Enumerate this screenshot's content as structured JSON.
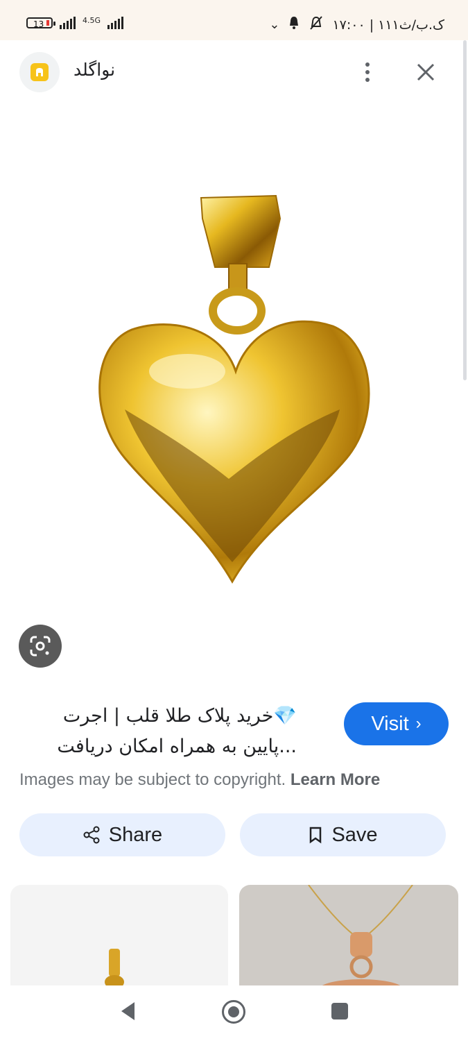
{
  "status_bar": {
    "battery": "13",
    "network": "4.5G",
    "time_text": "۱۷:۰۰ | ۱۱۱ک.ب/ث"
  },
  "header": {
    "site_name": "نواگلد",
    "app_icon": "navagold-app-icon",
    "menu_icon": "more-vert-icon",
    "close_icon": "close-icon"
  },
  "main_image": {
    "subject": "gold-heart-pendant"
  },
  "result": {
    "emoji": "💎",
    "title_line1": "💎خرید پلاک طلا قلب | اجرت",
    "title_line2": "...پایین به همراه امکان دریافت",
    "visit_label": "Visit",
    "copyright_text": "Images may be subject to copyright.",
    "learn_more": "Learn More"
  },
  "actions": {
    "share_label": "Share",
    "save_label": "Save"
  },
  "colors": {
    "accent": "#1a73e8",
    "button_bg": "#e8f0fe",
    "status_bar_bg": "#fbf5ee",
    "gold": "#d4a514"
  }
}
